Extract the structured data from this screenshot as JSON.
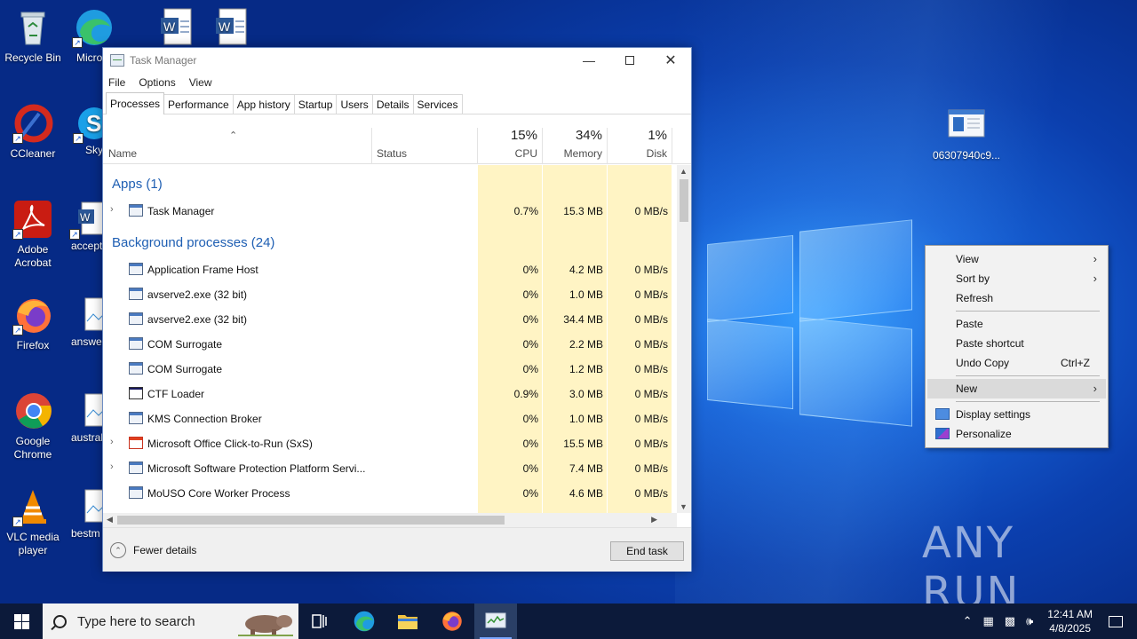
{
  "desktop": {
    "icons": [
      {
        "label": "Recycle Bin"
      },
      {
        "label": "Microsoft Edge"
      },
      {
        "label": "CCleaner"
      },
      {
        "label": "Skype"
      },
      {
        "label": "Adobe Acrobat"
      },
      {
        "label": "accept"
      },
      {
        "label": "Firefox"
      },
      {
        "label": "answer"
      },
      {
        "label": "Google Chrome"
      },
      {
        "label": "austral"
      },
      {
        "label": "VLC media player"
      },
      {
        "label": "bestm"
      },
      {
        "label": "06307940c9..."
      }
    ]
  },
  "task_manager": {
    "title": "Task Manager",
    "menu": [
      "File",
      "Options",
      "View"
    ],
    "tabs": [
      "Processes",
      "Performance",
      "App history",
      "Startup",
      "Users",
      "Details",
      "Services"
    ],
    "active_tab": "Processes",
    "columns": {
      "name": "Name",
      "status": "Status",
      "cpu_pct": "15%",
      "cpu": "CPU",
      "mem_pct": "34%",
      "mem": "Memory",
      "disk_pct": "1%",
      "disk": "Disk"
    },
    "groups": {
      "apps": "Apps (1)",
      "background": "Background processes (24)"
    },
    "apps": [
      {
        "name": "Task Manager",
        "cpu": "0.7%",
        "mem": "15.3 MB",
        "disk": "0 MB/s"
      }
    ],
    "background": [
      {
        "name": "Application Frame Host",
        "cpu": "0%",
        "mem": "4.2 MB",
        "disk": "0 MB/s"
      },
      {
        "name": "avserve2.exe (32 bit)",
        "cpu": "0%",
        "mem": "1.0 MB",
        "disk": "0 MB/s"
      },
      {
        "name": "avserve2.exe (32 bit)",
        "cpu": "0%",
        "mem": "34.4 MB",
        "disk": "0 MB/s"
      },
      {
        "name": "COM Surrogate",
        "cpu": "0%",
        "mem": "2.2 MB",
        "disk": "0 MB/s"
      },
      {
        "name": "COM Surrogate",
        "cpu": "0%",
        "mem": "1.2 MB",
        "disk": "0 MB/s"
      },
      {
        "name": "CTF Loader",
        "cpu": "0.9%",
        "mem": "3.0 MB",
        "disk": "0 MB/s"
      },
      {
        "name": "KMS Connection Broker",
        "cpu": "0%",
        "mem": "1.0 MB",
        "disk": "0 MB/s"
      },
      {
        "name": "Microsoft Office Click-to-Run (SxS)",
        "cpu": "0%",
        "mem": "15.5 MB",
        "disk": "0 MB/s"
      },
      {
        "name": "Microsoft Software Protection Platform Servi...",
        "cpu": "0%",
        "mem": "7.4 MB",
        "disk": "0 MB/s"
      },
      {
        "name": "MoUSO Core Worker Process",
        "cpu": "0%",
        "mem": "4.6 MB",
        "disk": "0 MB/s"
      }
    ],
    "fewer_details": "Fewer details",
    "end_task": "End task"
  },
  "context_menu": {
    "view": "View",
    "sort_by": "Sort by",
    "refresh": "Refresh",
    "paste": "Paste",
    "paste_shortcut": "Paste shortcut",
    "undo_copy": "Undo Copy",
    "undo_accel": "Ctrl+Z",
    "new": "New",
    "display_settings": "Display settings",
    "personalize": "Personalize"
  },
  "taskbar": {
    "search_placeholder": "Type here to search",
    "time": "12:41 AM",
    "date": "4/8/2025"
  },
  "watermark": "ANY RUN"
}
